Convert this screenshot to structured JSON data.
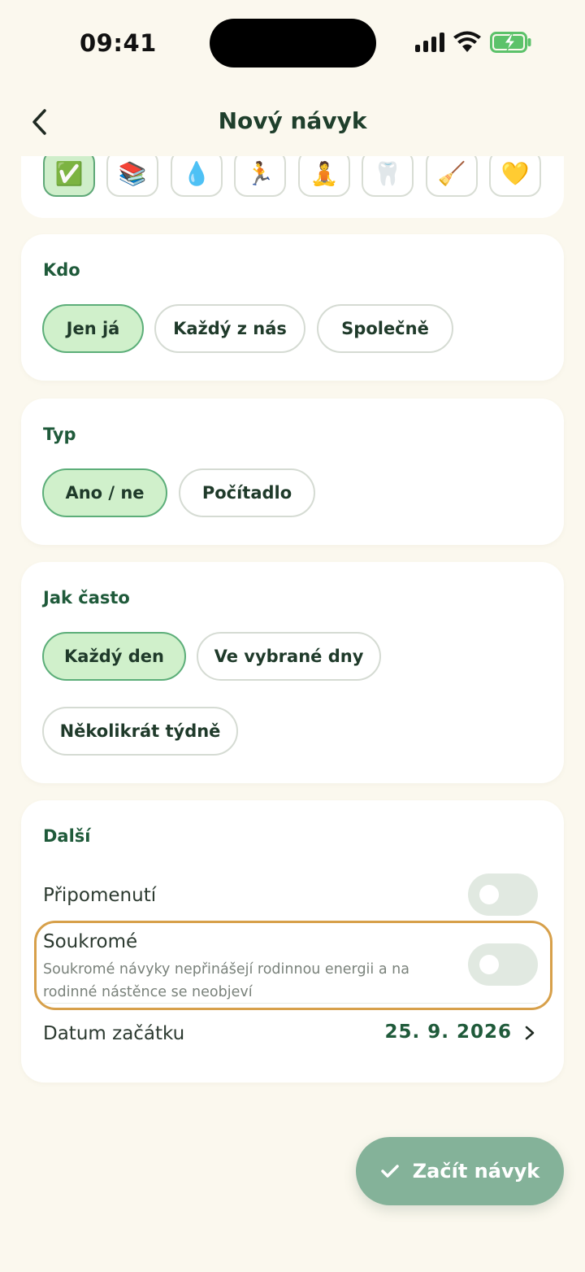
{
  "status_bar": {
    "time": "09:41"
  },
  "nav": {
    "title": "Nový návyk"
  },
  "icons": [
    "✅",
    "📚",
    "💧",
    "🏃",
    "🧘",
    "🦷",
    "🧹",
    "💛"
  ],
  "who": {
    "label": "Kdo",
    "options": [
      "Jen já",
      "Každý z nás",
      "Společně"
    ],
    "selected": "Jen já"
  },
  "type": {
    "label": "Typ",
    "options": [
      "Ano / ne",
      "Počítadlo"
    ],
    "selected": "Ano / ne"
  },
  "frequency": {
    "label": "Jak často",
    "options": [
      "Každý den",
      "Ve vybrané dny",
      "Několikrát týdně"
    ],
    "selected": "Každý den"
  },
  "more": {
    "label": "Další",
    "reminder_label": "Připomenutí",
    "reminder_on": false,
    "private_label": "Soukromé",
    "private_desc": "Soukromé návyky nepřinášejí rodinnou energii a na rodinné nástěnce se neobjeví",
    "private_on": false,
    "start_date_label": "Datum začátku",
    "start_date_value": "25. 9. 2026"
  },
  "start_button": {
    "label": "Začít návyk"
  },
  "colors": {
    "accent": "#1f5a3a",
    "selected_fill": "#d0f0cb",
    "highlight": "#d7a04a",
    "button": "#84b299"
  }
}
